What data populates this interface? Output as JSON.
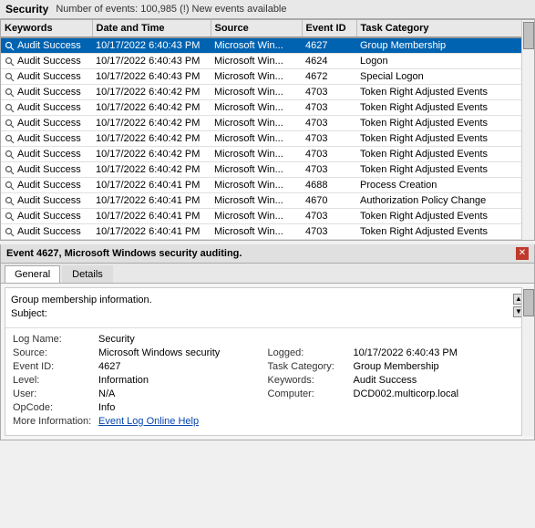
{
  "titlebar": {
    "app": "Security",
    "info": "Number of events: 100,985 (!) New events available"
  },
  "table": {
    "columns": [
      "Keywords",
      "Date and Time",
      "Source",
      "Event ID",
      "Task Category"
    ],
    "rows": [
      {
        "keyword": "Audit Success",
        "datetime": "10/17/2022 6:40:43 PM",
        "source": "Microsoft Win...",
        "eventid": "4627",
        "category": "Group Membership",
        "selected": true
      },
      {
        "keyword": "Audit Success",
        "datetime": "10/17/2022 6:40:43 PM",
        "source": "Microsoft Win...",
        "eventid": "4624",
        "category": "Logon",
        "selected": false
      },
      {
        "keyword": "Audit Success",
        "datetime": "10/17/2022 6:40:43 PM",
        "source": "Microsoft Win...",
        "eventid": "4672",
        "category": "Special Logon",
        "selected": false
      },
      {
        "keyword": "Audit Success",
        "datetime": "10/17/2022 6:40:42 PM",
        "source": "Microsoft Win...",
        "eventid": "4703",
        "category": "Token Right Adjusted Events",
        "selected": false
      },
      {
        "keyword": "Audit Success",
        "datetime": "10/17/2022 6:40:42 PM",
        "source": "Microsoft Win...",
        "eventid": "4703",
        "category": "Token Right Adjusted Events",
        "selected": false
      },
      {
        "keyword": "Audit Success",
        "datetime": "10/17/2022 6:40:42 PM",
        "source": "Microsoft Win...",
        "eventid": "4703",
        "category": "Token Right Adjusted Events",
        "selected": false
      },
      {
        "keyword": "Audit Success",
        "datetime": "10/17/2022 6:40:42 PM",
        "source": "Microsoft Win...",
        "eventid": "4703",
        "category": "Token Right Adjusted Events",
        "selected": false
      },
      {
        "keyword": "Audit Success",
        "datetime": "10/17/2022 6:40:42 PM",
        "source": "Microsoft Win...",
        "eventid": "4703",
        "category": "Token Right Adjusted Events",
        "selected": false
      },
      {
        "keyword": "Audit Success",
        "datetime": "10/17/2022 6:40:42 PM",
        "source": "Microsoft Win...",
        "eventid": "4703",
        "category": "Token Right Adjusted Events",
        "selected": false
      },
      {
        "keyword": "Audit Success",
        "datetime": "10/17/2022 6:40:41 PM",
        "source": "Microsoft Win...",
        "eventid": "4688",
        "category": "Process Creation",
        "selected": false
      },
      {
        "keyword": "Audit Success",
        "datetime": "10/17/2022 6:40:41 PM",
        "source": "Microsoft Win...",
        "eventid": "4670",
        "category": "Authorization Policy Change",
        "selected": false
      },
      {
        "keyword": "Audit Success",
        "datetime": "10/17/2022 6:40:41 PM",
        "source": "Microsoft Win...",
        "eventid": "4703",
        "category": "Token Right Adjusted Events",
        "selected": false
      },
      {
        "keyword": "Audit Success",
        "datetime": "10/17/2022 6:40:41 PM",
        "source": "Microsoft Win...",
        "eventid": "4703",
        "category": "Token Right Adjusted Events",
        "selected": false
      }
    ]
  },
  "detail": {
    "title": "Event 4627, Microsoft Windows security auditing.",
    "tabs": [
      "General",
      "Details"
    ],
    "active_tab": "General",
    "textarea_lines": [
      "Group membership information.",
      "Subject:"
    ],
    "fields": [
      {
        "label": "Log Name:",
        "value": "Security"
      },
      {
        "label": "Source:",
        "value": "Microsoft Windows security",
        "label2": "Logged:",
        "value2": "10/17/2022 6:40:43 PM"
      },
      {
        "label": "Event ID:",
        "value": "4627",
        "label2": "Task Category:",
        "value2": "Group Membership"
      },
      {
        "label": "Level:",
        "value": "Information",
        "label2": "Keywords:",
        "value2": "Audit Success"
      },
      {
        "label": "User:",
        "value": "N/A",
        "label2": "Computer:",
        "value2": "DCD002.multicorp.local"
      },
      {
        "label": "OpCode:",
        "value": "Info"
      },
      {
        "label": "More Information:",
        "value": "Event Log Online Help",
        "is_link": true
      }
    ]
  },
  "colors": {
    "selected_bg": "#0063b1",
    "selected_text": "#ffffff",
    "link_color": "#0645ad"
  }
}
